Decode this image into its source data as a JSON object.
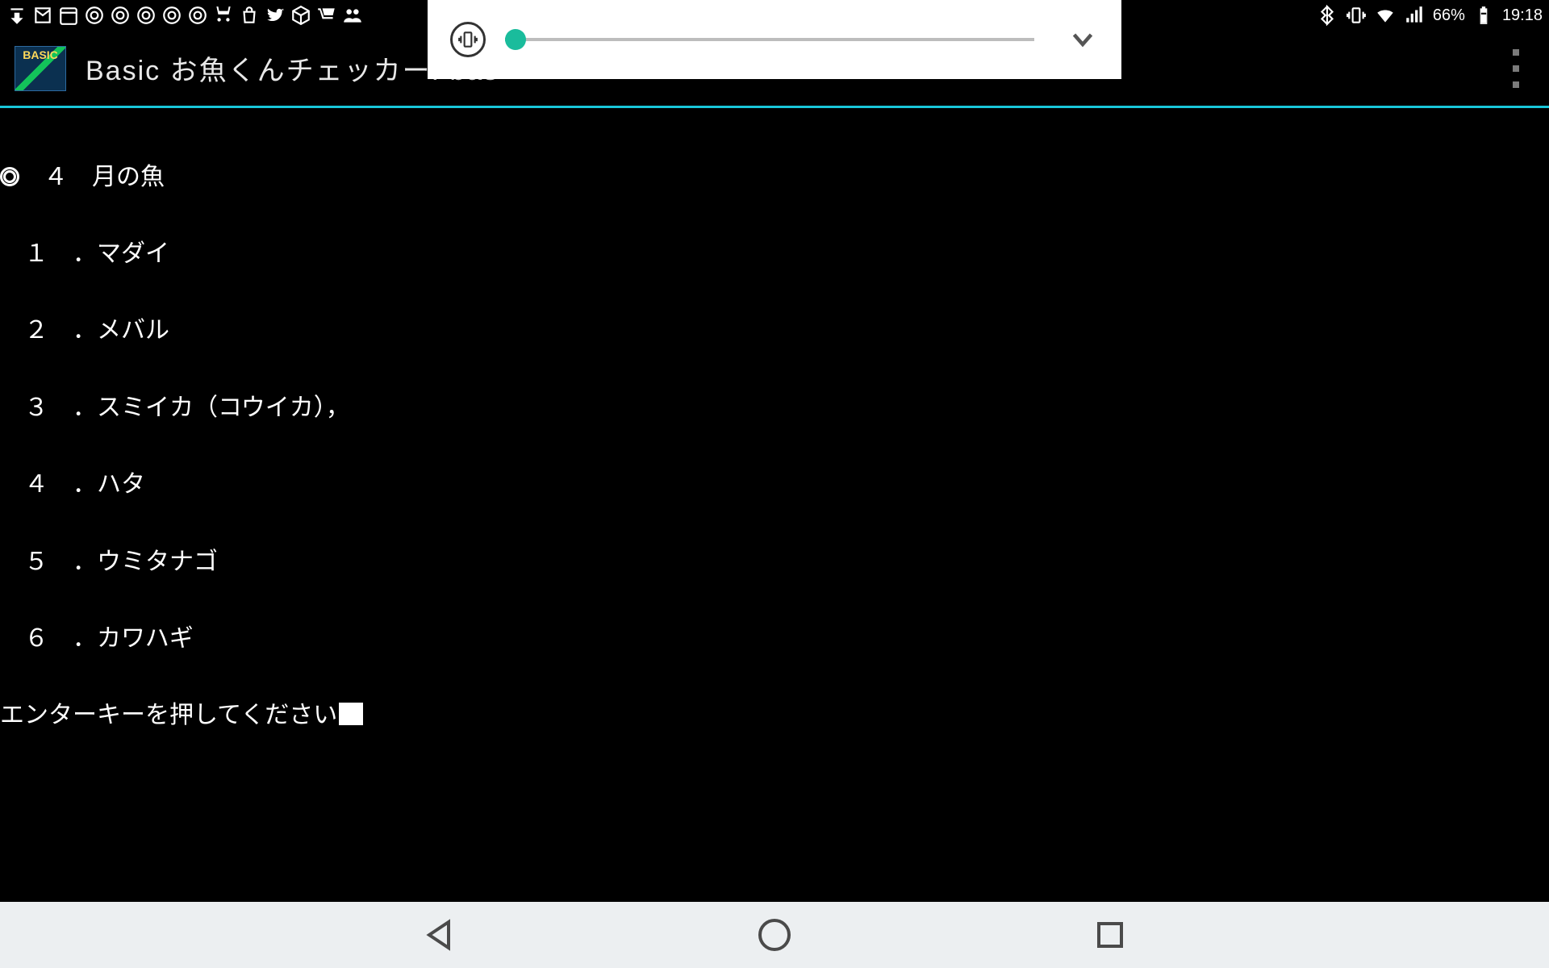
{
  "status_bar": {
    "battery_text": "66%",
    "clock": "19:18",
    "left_icons": [
      "download-icon",
      "gmail-icon",
      "calendar-icon",
      "chrome-icon",
      "chrome-icon",
      "chrome-icon",
      "chrome-icon",
      "chrome-icon",
      "shopping-icon",
      "bag-icon",
      "twitter-icon",
      "cube-icon",
      "cart-icon",
      "group-icon"
    ],
    "right_icons": [
      "bluetooth-icon",
      "vibrate-icon",
      "wifi-icon",
      "signal-icon",
      "battery-icon"
    ]
  },
  "volume_panel": {
    "mode": "vibrate",
    "level_percent": 2
  },
  "app_bar": {
    "icon_label": "BASIC",
    "title": "Basic お魚くんチェッカー. bas"
  },
  "terminal": {
    "header_prefix": "　４　月の魚",
    "items": [
      {
        "num": "１",
        "text": "マダイ"
      },
      {
        "num": "２",
        "text": "メバル"
      },
      {
        "num": "３",
        "text": "スミイカ（コウイカ），"
      },
      {
        "num": "４",
        "text": "ハタ"
      },
      {
        "num": "５",
        "text": "ウミタナゴ"
      },
      {
        "num": "６",
        "text": "カワハギ"
      }
    ],
    "prompt": "エンターキーを押してください"
  },
  "nav_bar": {
    "buttons": [
      "back",
      "home",
      "recent"
    ]
  }
}
